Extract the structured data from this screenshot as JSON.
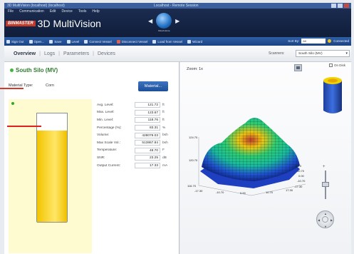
{
  "window": {
    "title": "3D MultiVision (localhost) (localhost)",
    "center_title": "Localhost - Remote Session"
  },
  "menu": [
    "File",
    "Communication",
    "Edit",
    "Device",
    "Tools",
    "Help"
  ],
  "brand": {
    "logo": "BINMASTER",
    "app_name": "3D MultiVision"
  },
  "nav": {
    "globe_label": "Cloud Home"
  },
  "toolbar": {
    "items": [
      "Sign Out",
      "Open...",
      "Save",
      "Level",
      "Connect Vessel",
      "Disconnect Vessel",
      "Load from Vessel",
      "Wizard"
    ],
    "sort_label": "Sort By:",
    "sort_value": "All",
    "connect_label": "Connected"
  },
  "tabs": [
    "Overview",
    "Logs",
    "Parameters",
    "Devices"
  ],
  "scanners": {
    "label": "Scanners:",
    "value": "South Silo (MV)"
  },
  "silo": {
    "name": "South Silo (MV)",
    "material_label": "Material Type:",
    "material_value": "Corn",
    "material_button": "Material...",
    "fill_percent": 83.31
  },
  "readings": [
    {
      "label": "Avg. Level:",
      "value": "121.72",
      "unit": "ft"
    },
    {
      "label": "Max. Level:",
      "value": "123.67",
      "unit": "ft"
    },
    {
      "label": "Min. Level:",
      "value": "118.76",
      "unit": "ft"
    },
    {
      "label": "Percentage (%):",
      "value": "83.31",
      "unit": "%"
    },
    {
      "label": "Volume:",
      "value": "428079.03",
      "unit": "bsh"
    },
    {
      "label": "Max Scale Vol.:",
      "value": "513867.84",
      "unit": "bsh"
    },
    {
      "label": "Temperature:",
      "value": "48.70",
      "unit": "F"
    },
    {
      "label": "SNR:",
      "value": "23.25",
      "unit": "dB"
    },
    {
      "label": "Output Current:",
      "value": "17.33",
      "unit": "mA"
    }
  ],
  "view3d": {
    "zoom_label": "Zoom: 1x",
    "on_disk_label": "On Disk",
    "z_ticks": [
      "124.70",
      "120.70",
      "116.70"
    ],
    "x_ticks": [
      "-17.30",
      "-10.70",
      "0.00",
      "10.70",
      "17.30"
    ],
    "y_ticks": [
      "15.70",
      "10.70",
      "0.00",
      "-10.70",
      "-17.30"
    ]
  },
  "colors": {
    "header": "#1d2f55",
    "toolbar": "#2f5fa6",
    "silo_fill": "#f3c400",
    "accent_red": "#d23a2b",
    "status_green": "#2e7d2e"
  }
}
